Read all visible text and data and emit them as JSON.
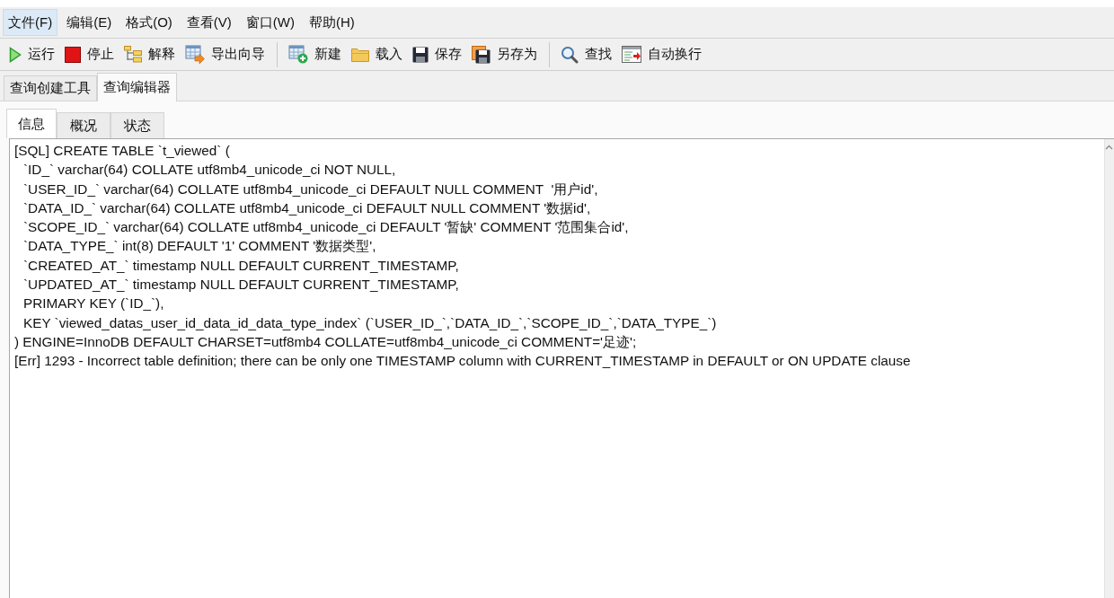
{
  "menu": [
    {
      "label": "文件(F)",
      "selected": true
    },
    {
      "label": "编辑(E)",
      "selected": false
    },
    {
      "label": "格式(O)",
      "selected": false
    },
    {
      "label": "查看(V)",
      "selected": false
    },
    {
      "label": "窗口(W)",
      "selected": false
    },
    {
      "label": "帮助(H)",
      "selected": false
    }
  ],
  "toolbar": [
    [
      "运行",
      "停止",
      "解释",
      "导出向导"
    ],
    [
      "新建",
      "载入",
      "保存",
      "另存为"
    ],
    [
      "查找",
      "自动换行"
    ]
  ],
  "document_tabs": [
    {
      "label": "查询创建工具",
      "selected": false
    },
    {
      "label": "查询编辑器",
      "selected": true
    }
  ],
  "result_tabs": [
    {
      "label": "信息",
      "selected": true
    },
    {
      "label": "概况",
      "selected": false
    },
    {
      "label": "状态",
      "selected": false
    }
  ],
  "message_log": [
    {
      "text": "[SQL] CREATE TABLE `t_viewed` (",
      "children": [
        {
          "text": "`ID_` varchar(64) COLLATE utf8mb4_unicode_ci NOT NULL,"
        },
        {
          "text": "`USER_ID_` varchar(64) COLLATE utf8mb4_unicode_ci DEFAULT NULL COMMENT  '用户id',"
        },
        {
          "text": "`DATA_ID_` varchar(64) COLLATE utf8mb4_unicode_ci DEFAULT NULL COMMENT '数据id',"
        },
        {
          "text": "`SCOPE_ID_` varchar(64) COLLATE utf8mb4_unicode_ci DEFAULT '暂缺' COMMENT '范围集合id',"
        },
        {
          "text": "`DATA_TYPE_` int(8) DEFAULT '1' COMMENT '数据类型',"
        },
        {
          "text": "`CREATED_AT_` timestamp NULL DEFAULT CURRENT_TIMESTAMP,"
        },
        {
          "text": "`UPDATED_AT_` timestamp NULL DEFAULT CURRENT_TIMESTAMP,"
        },
        {
          "text": "PRIMARY KEY (`ID_`),"
        },
        {
          "text": "KEY `viewed_datas_user_id_data_id_data_type_index` (`USER_ID_`,`DATA_ID_`,`SCOPE_ID_`,`DATA_TYPE_`)"
        }
      ]
    },
    {
      "text": ") ENGINE=InnoDB DEFAULT CHARSET=utf8mb4 COLLATE=utf8mb4_unicode_ci COMMENT='足迹';"
    },
    {
      "text": "[Err] 1293 - Incorrect table definition; there can be only one TIMESTAMP column with CURRENT_TIMESTAMP in DEFAULT or ON UPDATE clause"
    }
  ]
}
